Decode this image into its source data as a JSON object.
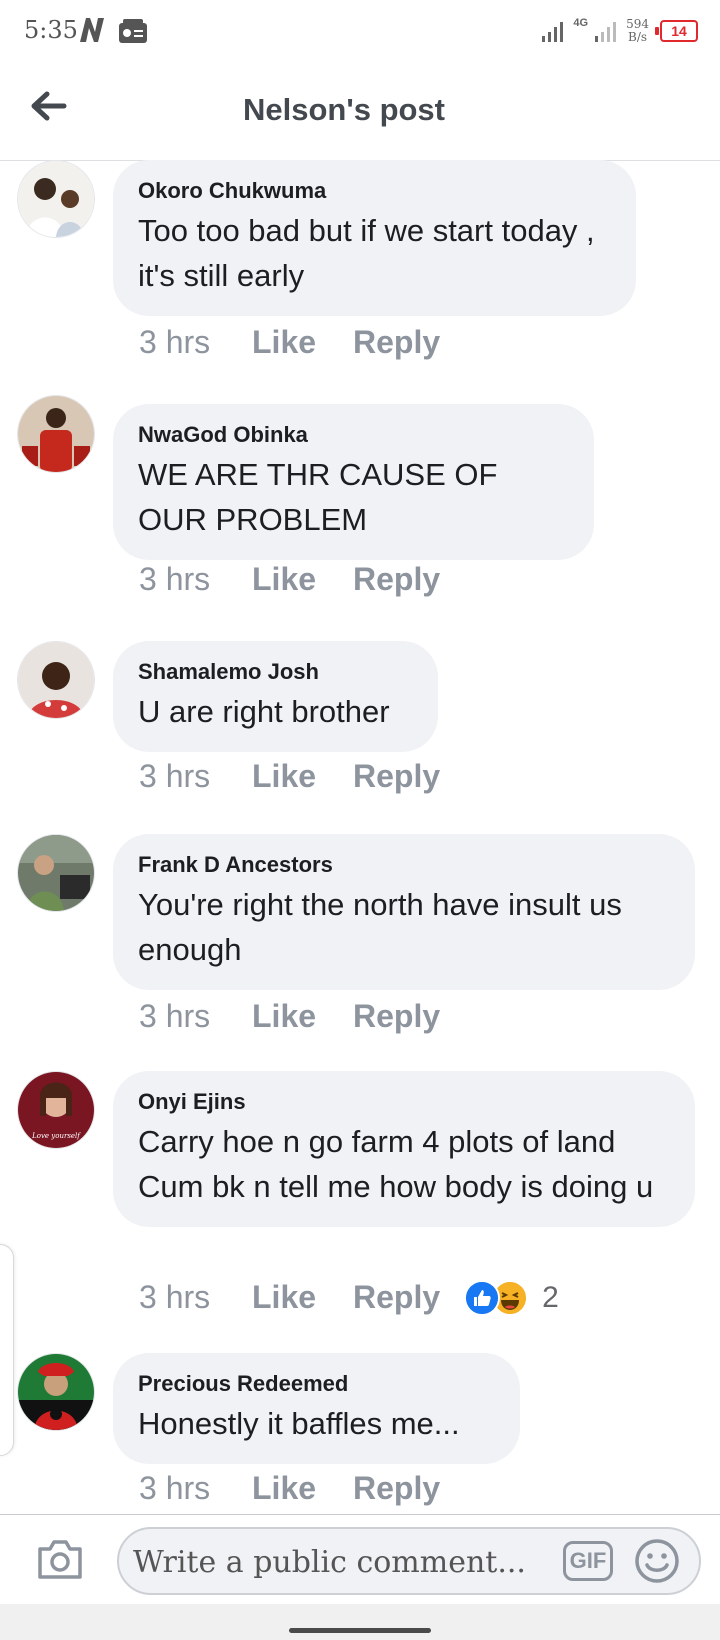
{
  "status_bar": {
    "time": "5:35",
    "network": "4G",
    "speed": "594",
    "speed_unit": "B/s",
    "battery": "14"
  },
  "header": {
    "title": "Nelson's post",
    "back_icon": "arrow-left-icon"
  },
  "comments": [
    {
      "author": "Okoro Chukwuma",
      "text": "Too too bad but if we start today , it's still early",
      "time": "3 hrs",
      "like": "Like",
      "reply": "Reply"
    },
    {
      "author": "NwaGod Obinka",
      "text": "WE ARE THR CAUSE OF OUR PROBLEM",
      "time": "3 hrs",
      "like": "Like",
      "reply": "Reply"
    },
    {
      "author": "Shamalemo Josh",
      "text": "U are right brother",
      "time": "3 hrs",
      "like": "Like",
      "reply": "Reply"
    },
    {
      "author": "Frank D Ancestors",
      "text": "You're right the north have insult us enough",
      "time": "3 hrs",
      "like": "Like",
      "reply": "Reply"
    },
    {
      "author": "Onyi Ejins",
      "text": "Carry hoe n go farm 4 plots of land Cum bk n tell me how body is doing u",
      "time": "3 hrs",
      "like": "Like",
      "reply": "Reply",
      "reactions": {
        "icons": [
          "like-reaction-icon",
          "haha-reaction-icon"
        ],
        "count": "2"
      },
      "avatar_caption": "Love yourself"
    },
    {
      "author": "Precious Redeemed",
      "text": "Honestly it baffles me...",
      "time": "3 hrs",
      "like": "Like",
      "reply": "Reply"
    }
  ],
  "composer": {
    "placeholder": "Write a public comment...",
    "gif_label": "GIF",
    "camera_icon": "camera-icon",
    "emoji_icon": "smiley-icon"
  },
  "colors": {
    "bubble": "#f0f2f5",
    "meta_text": "#8d949e",
    "battery_low": "#e0282d",
    "like_blue": "#1877f2",
    "haha_yellow": "#f7b125"
  }
}
